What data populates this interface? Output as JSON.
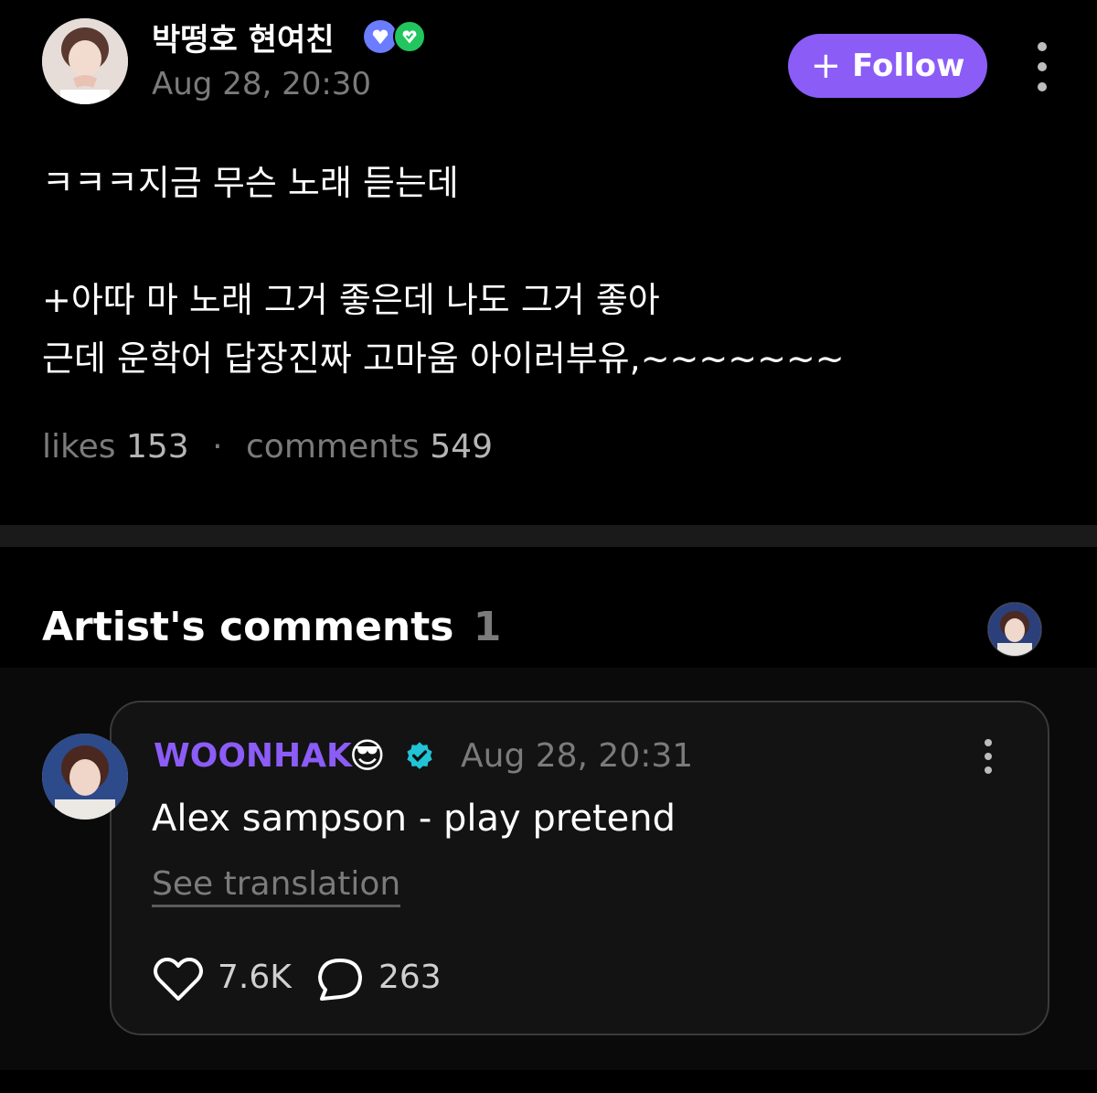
{
  "post": {
    "username": "박떵호 현여친",
    "timestamp": "Aug 28, 20:30",
    "follow_label": "Follow",
    "body_line1": "ㅋㅋㅋ지금 무슨 노래 듣는데",
    "body_line2": "+아따 마 노래 그거 좋은데 나도 그거 좋아",
    "body_line3": "근데 운학어 답장진짜 고마움 아이러부유,~~~~~~~",
    "likes_label": "likes",
    "likes_count": "153",
    "separator": "·",
    "comments_label": "comments",
    "comments_count": "549"
  },
  "artist_comments": {
    "title": "Artist's comments",
    "count": "1"
  },
  "comment": {
    "author": "WOONHAK",
    "emoji": "😎",
    "timestamp": "Aug 28, 20:31",
    "text": "Alex sampson - play pretend",
    "see_translation": "See translation",
    "like_count": "7.6K",
    "reply_count": "263"
  },
  "colors": {
    "accent": "#8b5cf6",
    "verified": "#22c3d6",
    "muted": "#7b7b7b"
  }
}
